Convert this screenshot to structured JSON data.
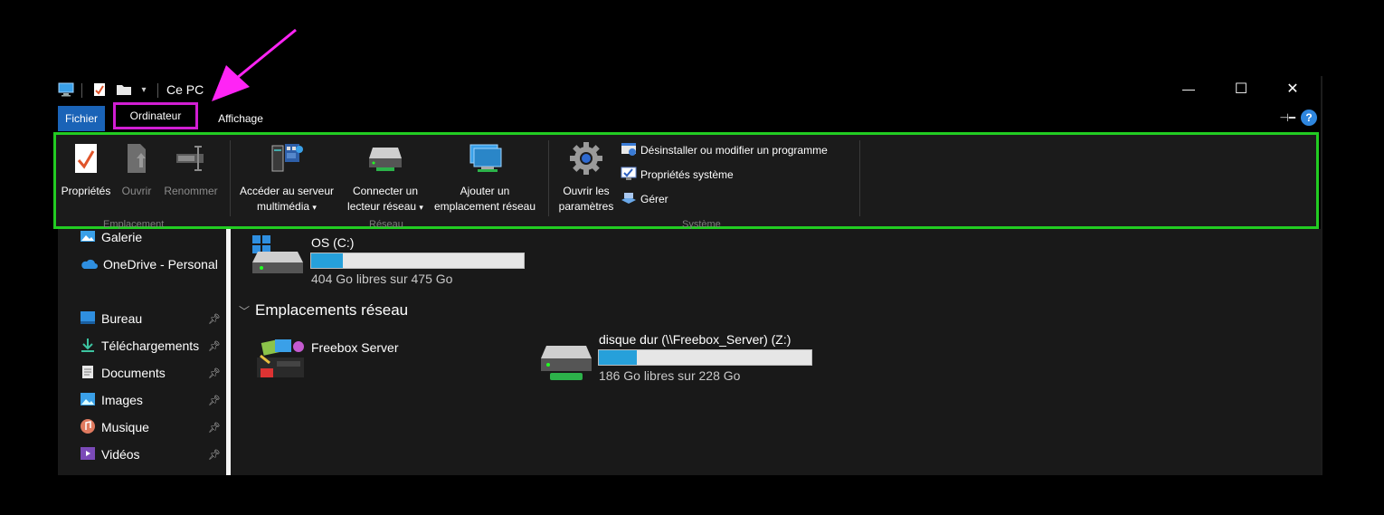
{
  "titlebar": {
    "title": "Ce PC",
    "controls": {
      "minimize": "—",
      "maximize": "☐",
      "close": "✕"
    }
  },
  "ribbon_tabs": {
    "file": "Fichier",
    "computer": "Ordinateur",
    "view": "Affichage",
    "help": "?"
  },
  "ribbon": {
    "location": {
      "label": "Emplacement",
      "properties": "Propriétés",
      "open": "Ouvrir",
      "rename": "Renommer"
    },
    "network": {
      "label": "Réseau",
      "media_server_line1": "Accéder au serveur",
      "media_server_line2": "multimédia",
      "map_drive_line1": "Connecter un",
      "map_drive_line2": "lecteur réseau",
      "add_location_line1": "Ajouter un",
      "add_location_line2": "emplacement réseau"
    },
    "system": {
      "label": "Système",
      "open_settings_line1": "Ouvrir les",
      "open_settings_line2": "paramètres",
      "uninstall": "Désinstaller ou modifier un programme",
      "system_properties": "Propriétés système",
      "manage": "Gérer"
    }
  },
  "nav": {
    "items": [
      {
        "label": "Galerie",
        "icon": "gallery-icon",
        "pinned": false
      },
      {
        "label": "OneDrive - Personal",
        "icon": "onedrive-icon",
        "pinned": false
      },
      {
        "label": "Bureau",
        "icon": "desktop-icon",
        "pinned": true
      },
      {
        "label": "Téléchargements",
        "icon": "downloads-icon",
        "pinned": true
      },
      {
        "label": "Documents",
        "icon": "documents-icon",
        "pinned": true
      },
      {
        "label": "Images",
        "icon": "pictures-icon",
        "pinned": true
      },
      {
        "label": "Musique",
        "icon": "music-icon",
        "pinned": true
      },
      {
        "label": "Vidéos",
        "icon": "videos-icon",
        "pinned": true
      }
    ]
  },
  "content": {
    "drive_c": {
      "name": "OS (C:)",
      "free": "404 Go libres sur 475 Go",
      "used_fraction": 0.15
    },
    "network_section": "Emplacements réseau",
    "freebox": {
      "name": "Freebox Server"
    },
    "drive_z": {
      "name": "disque dur (\\\\Freebox_Server) (Z:)",
      "free": "186 Go libres sur 228 Go",
      "used_fraction": 0.18
    }
  },
  "colors": {
    "accent": "#1a63b7",
    "annotation_highlight": "#d11ed3",
    "ribbon_highlight": "#22cc22",
    "storage_bar": "#26a0da"
  }
}
